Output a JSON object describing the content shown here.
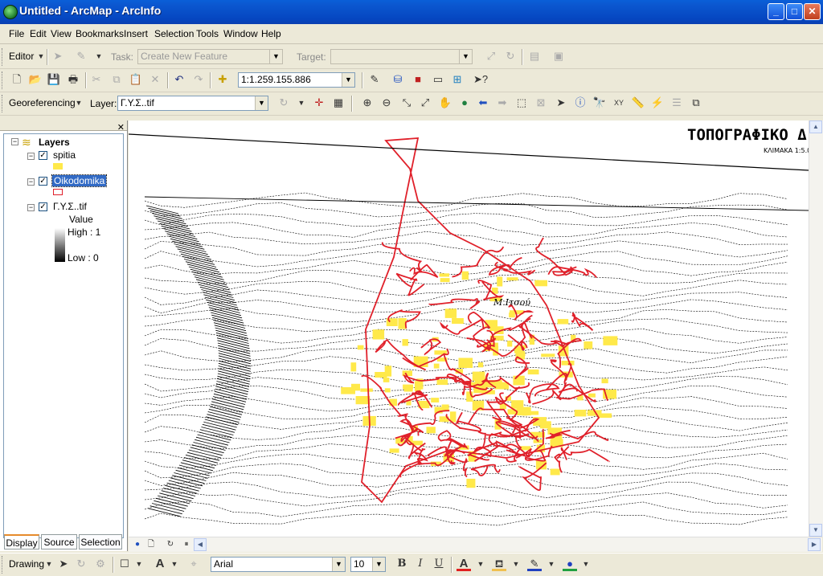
{
  "window": {
    "title": "Untitled - ArcMap - ArcInfo",
    "min": "_",
    "max": "□",
    "close": "✕"
  },
  "menu": [
    "File",
    "Edit",
    "View",
    "Bookmarks",
    "Insert",
    "Selection",
    "Tools",
    "Window",
    "Help"
  ],
  "editor": {
    "label": "Editor",
    "task_label": "Task:",
    "task_value": "Create New Feature",
    "target_label": "Target:",
    "target_value": ""
  },
  "standard": {
    "scale": "1:1.259.155.886"
  },
  "georef": {
    "label": "Georeferencing",
    "layer_label": "Layer:",
    "layer_value": "Γ.Υ.Σ..tif"
  },
  "toc": {
    "root": "Layers",
    "layers": [
      {
        "name": "spitia",
        "checked": true
      },
      {
        "name": "Oikodomika",
        "checked": true,
        "selected": true
      },
      {
        "name": "Γ.Υ.Σ..tif",
        "checked": true
      }
    ],
    "value_label": "Value",
    "high_label": "High : 1",
    "low_label": "Low : 0",
    "tabs": [
      "Display",
      "Source",
      "Selection"
    ],
    "close": "✕"
  },
  "map": {
    "title_text": "ΤΟΠΟΓΡΑΦΙΚΟ Δ",
    "subtitle_text": "ΚΛΙΜΑΚΑ 1:5.0",
    "place_text": "Μ.Ιτσού",
    "colors": {
      "outline": "#e0202a",
      "fill": "#ffe94a"
    }
  },
  "drawing": {
    "label": "Drawing",
    "font": "Arial",
    "size": "10",
    "bold": "B",
    "italic": "I",
    "underline": "U",
    "text_a": "A",
    "font_color": "#e02020",
    "fill_color": "#f0c050",
    "line_color": "#2040c0",
    "marker_color": "#20a040"
  }
}
